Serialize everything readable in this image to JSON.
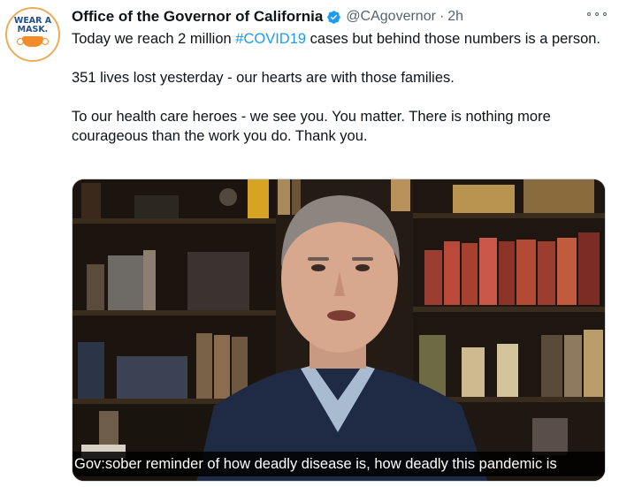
{
  "avatar": {
    "line1": "WEAR A",
    "line2": "MASK."
  },
  "header": {
    "display_name": "Office of the Governor of California",
    "handle": "@CAgovernor",
    "separator": "·",
    "time": "2h"
  },
  "tweet": {
    "line1_before": "Today we reach 2 million ",
    "hashtag": "#COVID19",
    "line1_after": " cases but behind those numbers is a person.",
    "line2": "351 lives lost yesterday - our hearts are with those families.",
    "line3": "To our health care heroes - we see you. You matter. There is nothing more courageous than the work you do. Thank you."
  },
  "video": {
    "caption": "Gov:sober reminder of how deadly disease is, how deadly this pandemic is"
  },
  "colors": {
    "link": "#1d9bf0",
    "verified": "#1d9bf0",
    "muted": "#536471",
    "mask_orange": "#f28c28",
    "avatar_text": "#1f4f8c"
  },
  "icons": {
    "verified": "verified-badge-icon",
    "more": "more-options-icon"
  }
}
